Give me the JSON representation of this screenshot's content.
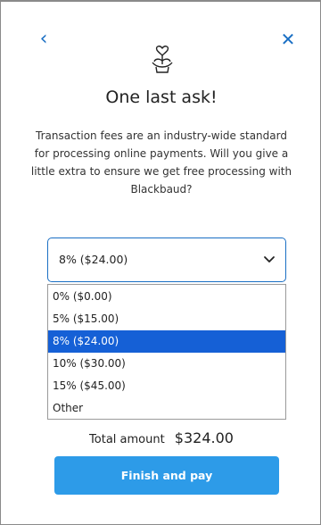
{
  "header": {
    "back_icon": "chevron-left-icon",
    "close_icon": "close-icon",
    "hero_icon": "heart-hands-plant-icon"
  },
  "title": "One last ask!",
  "description": "Transaction fees are an industry-wide standard for processing online payments. Will you give a little extra to ensure we get free processing with Blackbaud?",
  "fee_select": {
    "value": "8% ($24.00)",
    "options": [
      {
        "label": "0% ($0.00)",
        "selected": false
      },
      {
        "label": "5% ($15.00)",
        "selected": false
      },
      {
        "label": "8% ($24.00)",
        "selected": true
      },
      {
        "label": "10% ($30.00)",
        "selected": false
      },
      {
        "label": "15% ($45.00)",
        "selected": false
      },
      {
        "label": "Other",
        "selected": false
      }
    ]
  },
  "total": {
    "label": "Total amount",
    "value": "$324.00"
  },
  "actions": {
    "finish_label": "Finish and pay"
  },
  "colors": {
    "accent": "#1a6fc4",
    "button": "#2d9be8",
    "highlight": "#1560d6"
  }
}
